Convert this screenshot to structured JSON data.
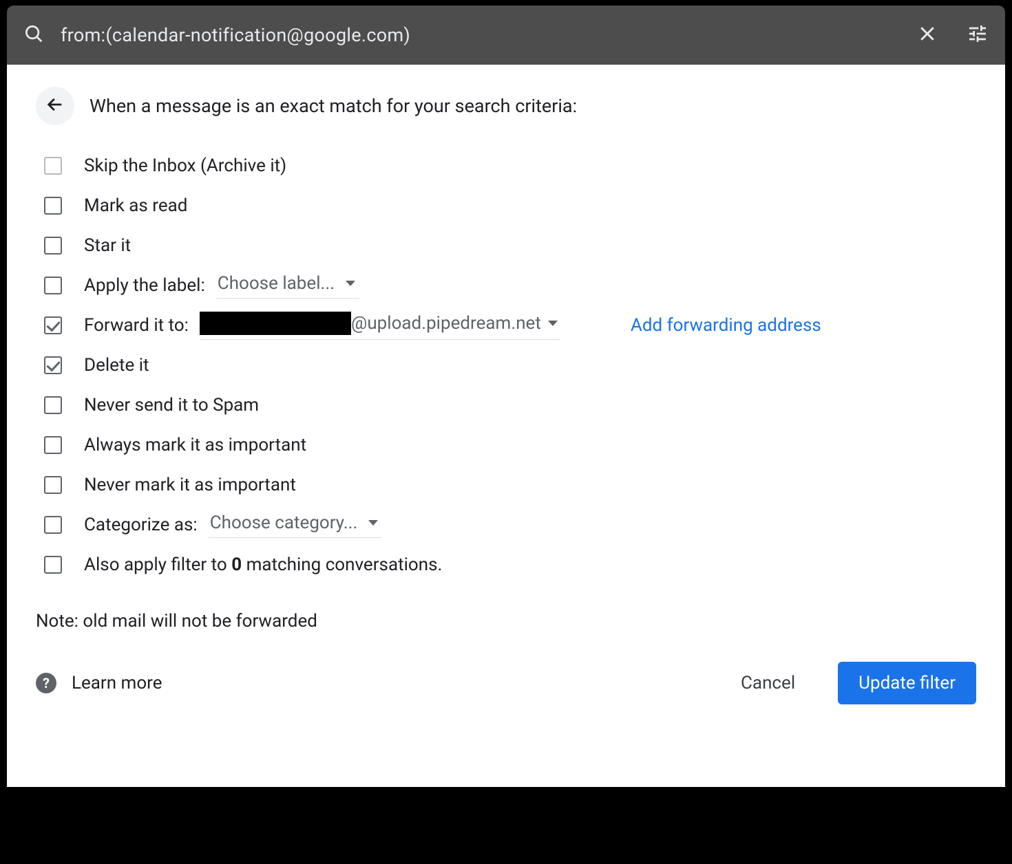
{
  "search": {
    "query": "from:(calendar-notification@google.com)"
  },
  "header": {
    "title": "When a message is an exact match for your search criteria:"
  },
  "options": {
    "skip_inbox": {
      "label": "Skip the Inbox (Archive it)",
      "checked": false
    },
    "mark_read": {
      "label": "Mark as read",
      "checked": false
    },
    "star_it": {
      "label": "Star it",
      "checked": false
    },
    "apply_label": {
      "label": "Apply the label:",
      "select_placeholder": "Choose label...",
      "checked": false
    },
    "forward": {
      "label": "Forward it to:",
      "redacted_prefix": "",
      "email_suffix": "@upload.pipedream.net",
      "add_link": "Add forwarding address",
      "checked": true
    },
    "delete_it": {
      "label": "Delete it",
      "checked": true
    },
    "never_spam": {
      "label": "Never send it to Spam",
      "checked": false
    },
    "always_important": {
      "label": "Always mark it as important",
      "checked": false
    },
    "never_important": {
      "label": "Never mark it as important",
      "checked": false
    },
    "categorize": {
      "label": "Categorize as:",
      "select_placeholder": "Choose category...",
      "checked": false
    },
    "also_apply": {
      "label_prefix": "Also apply filter to ",
      "count": "0",
      "label_suffix": " matching conversations.",
      "checked": false
    }
  },
  "note": "Note: old mail will not be forwarded",
  "footer": {
    "learn_more": "Learn more",
    "cancel": "Cancel",
    "update": "Update filter"
  }
}
